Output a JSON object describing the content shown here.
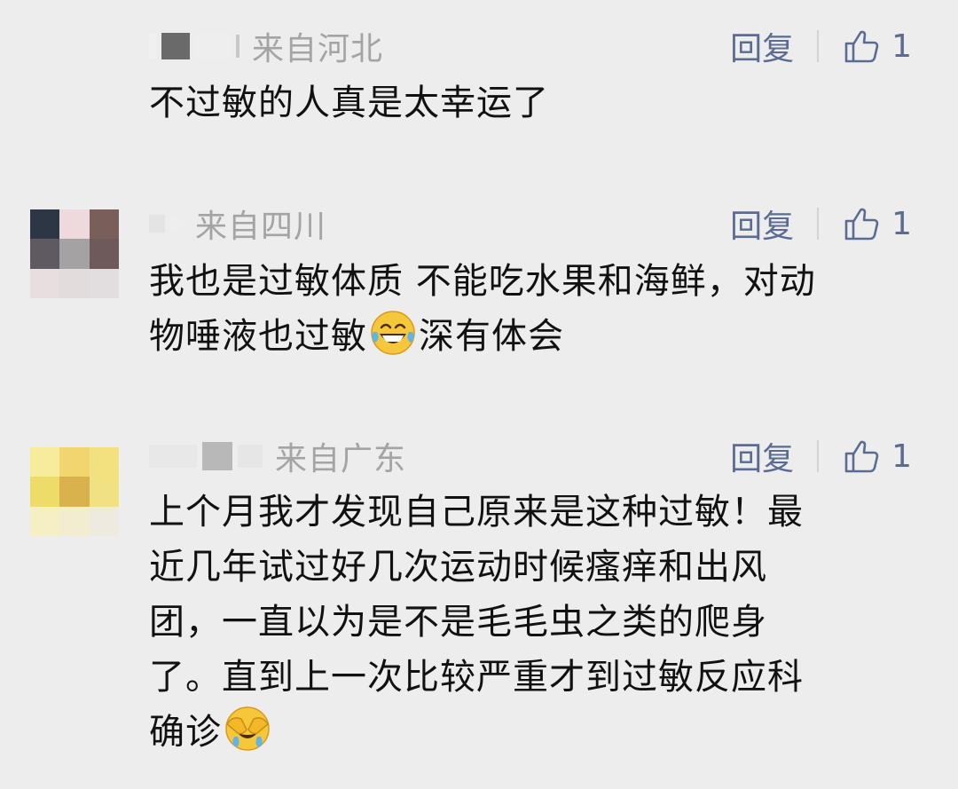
{
  "comments": [
    {
      "location": "来自河北",
      "reply_label": "回复",
      "like_count": "1",
      "text": "不过敏的人真是太幸运了"
    },
    {
      "location": "来自四川",
      "reply_label": "回复",
      "like_count": "1",
      "text_line1": "我也是过敏体质 不能吃水果和海鲜，对动",
      "text_line2a": "物唾液也过敏",
      "emoji1": "grinning-with-tears-emoji",
      "text_line2b": "深有体会"
    },
    {
      "location": "来自广东",
      "reply_label": "回复",
      "like_count": "1",
      "lines": [
        "上个月我才发现自己原来是这种过敏！最",
        "近几年试过好几次运动时候瘙痒和出风",
        "团，一直以为是不是毛毛虫之类的爬身",
        "了。直到上一次比较严重才到过敏反应科"
      ],
      "last_line": "确诊",
      "emoji2": "crying-face-covering-emoji"
    }
  ],
  "icons": {
    "like": "thumbs-up-icon"
  },
  "colors": {
    "background": "#ededed",
    "link": "#5b6b92",
    "meta": "#a4a4a4",
    "text": "#111111"
  }
}
